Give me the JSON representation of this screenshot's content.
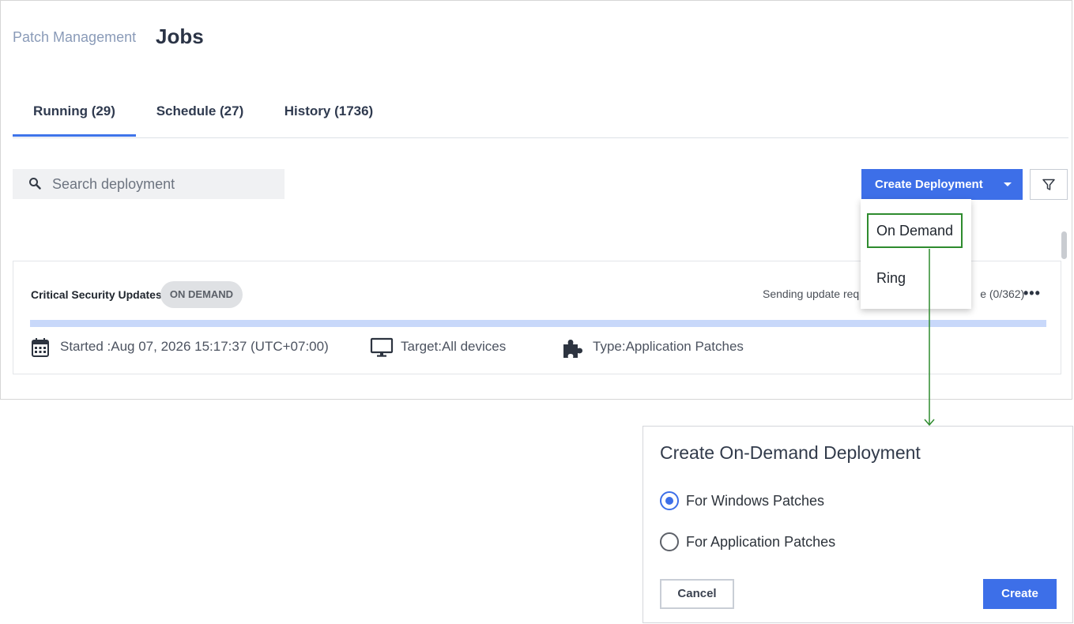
{
  "header": {
    "breadcrumb": "Patch Management",
    "title": "Jobs"
  },
  "tabs": [
    {
      "label": "Running (29)",
      "active": true
    },
    {
      "label": "Schedule (27)",
      "active": false
    },
    {
      "label": "History (1736)",
      "active": false
    }
  ],
  "search": {
    "placeholder": "Search deployment",
    "value": ""
  },
  "toolbar": {
    "create_label": "Create Deployment",
    "filter_icon": "filter-icon"
  },
  "dropdown": {
    "items": [
      {
        "label": "On Demand",
        "highlighted": true
      },
      {
        "label": "Ring",
        "highlighted": false
      }
    ]
  },
  "job": {
    "title": "Critical Security Updates",
    "badge": "ON DEMAND",
    "status_visible_start": "Sending update req",
    "status_visible_end": "e (0/362)",
    "progress": 0,
    "started": "Started :Aug 07, 2026 15:17:37 (UTC+07:00)",
    "target": "Target:All devices",
    "type": "Type:Application Patches"
  },
  "dialog": {
    "title": "Create On-Demand Deployment",
    "options": [
      {
        "label": "For Windows Patches",
        "selected": true
      },
      {
        "label": "For Application Patches",
        "selected": false
      }
    ],
    "cancel_label": "Cancel",
    "create_label": "Create"
  },
  "colors": {
    "accent": "#3d6fe8",
    "highlight": "#2e8b2e",
    "progress_track": "#c8d8fa"
  }
}
